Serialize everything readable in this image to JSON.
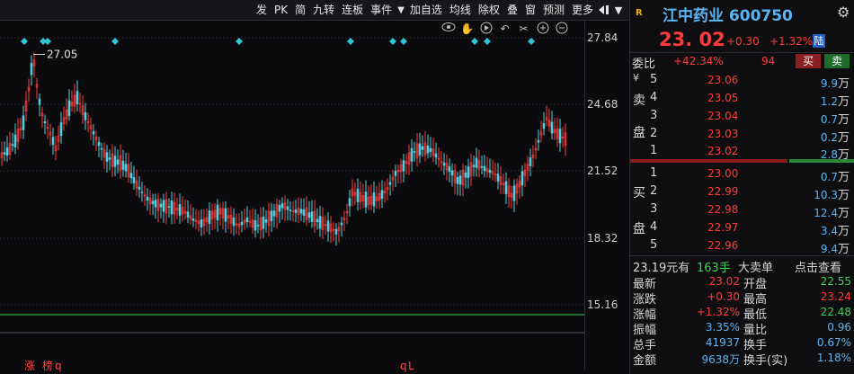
{
  "toolbar": {
    "items": [
      "发",
      "PK",
      "简",
      "九转",
      "连板",
      "事件",
      "加自选",
      "均线",
      "除权",
      "叠",
      "窗",
      "预测",
      "更多"
    ],
    "arrow": "▼"
  },
  "chart_tools": [
    "eye-icon",
    "hand-icon",
    "play-icon",
    "undo-icon",
    "scissors-icon",
    "zoom-in-icon",
    "zoom-out-icon"
  ],
  "chart": {
    "max_label": "27.05",
    "axis_labels": [
      "27.84",
      "24.68",
      "21.52",
      "18.32",
      "15.16"
    ],
    "colors": {
      "up": "#ff3b3b",
      "down": "#4fd0e0",
      "grid": "#3a3a3e",
      "marker": "#2fc8d8",
      "ma": "#2dd24a"
    }
  },
  "bottom_tags": {
    "left1": "涨",
    "left2": "榜",
    "left3": "q",
    "mid1": "q",
    "mid2": "L"
  },
  "quote": {
    "badge": "R",
    "title": "江中药业 600750",
    "price": "23. 02",
    "change": "+0.30",
    "change_pct": "+1.32%",
    "lu": "陆",
    "weibi_label": "委比",
    "weibi_ratio": "+42.34%",
    "weibi_diff": "94",
    "buy_label": "买",
    "sell_label": "卖",
    "sell_side": [
      "卖",
      "盘"
    ],
    "buy_side": [
      "买",
      "盘"
    ],
    "sell_levels": [
      {
        "level": "5",
        "price": "23.06",
        "vol": "9.9",
        "unit": "万"
      },
      {
        "level": "4",
        "price": "23.05",
        "vol": "1.2",
        "unit": "万"
      },
      {
        "level": "3",
        "price": "23.04",
        "vol": "0.7",
        "unit": "万"
      },
      {
        "level": "2",
        "price": "23.03",
        "vol": "0.2",
        "unit": "万"
      },
      {
        "level": "1",
        "price": "23.02",
        "vol": "2.8",
        "unit": "万"
      }
    ],
    "buy_levels": [
      {
        "level": "1",
        "price": "23.00",
        "vol": "0.7",
        "unit": "万"
      },
      {
        "level": "2",
        "price": "22.99",
        "vol": "10.3",
        "unit": "万"
      },
      {
        "level": "3",
        "price": "22.98",
        "vol": "12.4",
        "unit": "万"
      },
      {
        "level": "4",
        "price": "22.97",
        "vol": "3.4",
        "unit": "万"
      },
      {
        "level": "5",
        "price": "22.96",
        "vol": "9.4",
        "unit": "万"
      }
    ],
    "yen": "¥",
    "summary": {
      "amount": "23.19元有",
      "lots": "163手",
      "big": "大卖单",
      "link": "点击查看"
    },
    "stats": [
      {
        "l1": "最新",
        "v1": "23.02",
        "c1": "red",
        "l2": "开盘",
        "v2": "22.55",
        "c2": "green"
      },
      {
        "l1": "涨跌",
        "v1": "+0.30",
        "c1": "red",
        "l2": "最高",
        "v2": "23.24",
        "c2": "red"
      },
      {
        "l1": "涨幅",
        "v1": "+1.32%",
        "c1": "red",
        "l2": "最低",
        "v2": "22.48",
        "c2": "green"
      },
      {
        "l1": "振幅",
        "v1": "3.35%",
        "c1": "white",
        "l2": "量比",
        "v2": "0.96",
        "c2": "white"
      },
      {
        "l1": "总手",
        "v1": "41937",
        "c1": "white",
        "l2": "换手",
        "v2": "0.67%",
        "c2": "white"
      },
      {
        "l1": "金额",
        "v1": "9638万",
        "c1": "white",
        "l2": "换手(实)",
        "v2": "1.18%",
        "c2": "white"
      }
    ]
  }
}
